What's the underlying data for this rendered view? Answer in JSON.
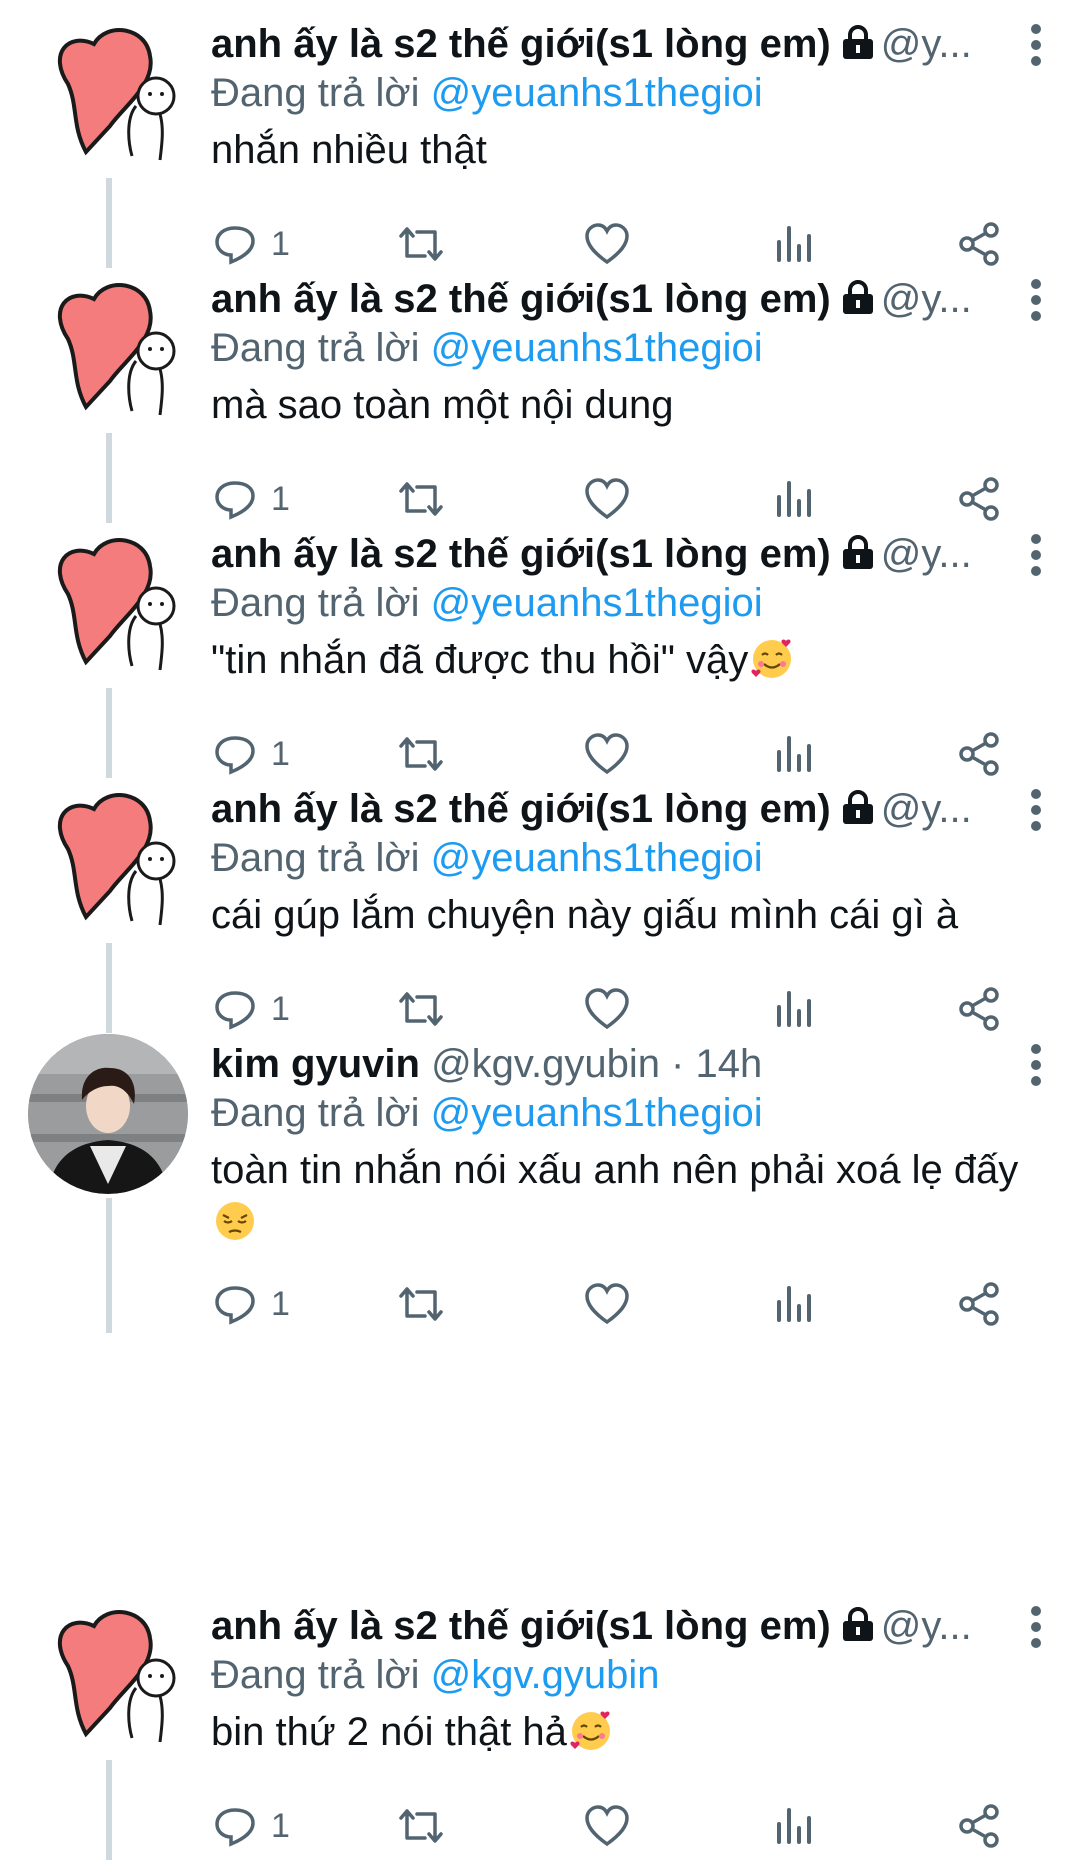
{
  "tweets": [
    {
      "name": "anh ấy là s2 thế giới(s1 lòng em)",
      "handle": "@y...",
      "reply_prefix": "Đang trả lời",
      "reply_to": "@yeuanhs1thegioi",
      "text": "nhắn nhiều thật",
      "reply_count": "1"
    },
    {
      "name": "anh ấy là s2 thế giới(s1 lòng em)",
      "handle": "@y...",
      "reply_prefix": "Đang trả lời",
      "reply_to": "@yeuanhs1thegioi",
      "text": "mà sao toàn một nội dung",
      "reply_count": "1"
    },
    {
      "name": "anh ấy là s2 thế giới(s1 lòng em)",
      "handle": "@y...",
      "reply_prefix": "Đang trả lời",
      "reply_to": "@yeuanhs1thegioi",
      "text": "\"tin nhắn đã được thu hồi\" vậy",
      "emoji": "smiling-hearts-emoji",
      "reply_count": "1"
    },
    {
      "name": "anh ấy là s2 thế giới(s1 lòng em)",
      "handle": "@y...",
      "reply_prefix": "Đang trả lời",
      "reply_to": "@yeuanhs1thegioi",
      "text": "cái gúp lắm chuyện này giấu mình cái gì à",
      "reply_count": "1"
    },
    {
      "name": "kim gyuvin",
      "handle": "@kgv.gyubin · 14h",
      "reply_prefix": "Đang trả lời",
      "reply_to": "@yeuanhs1thegioi",
      "text": "toàn tin nhắn nói xấu anh nên phải xoá lẹ đấy",
      "emoji": "pensive-emoji",
      "reply_count": "1"
    },
    {
      "name": "anh ấy là s2 thế giới(s1 lòng em)",
      "handle": "@y...",
      "reply_prefix": "Đang trả lời",
      "reply_to": "@kgv.gyubin",
      "text": "bin thứ 2 nói thật hả",
      "emoji": "smiling-hearts-emoji",
      "reply_count": "1"
    }
  ],
  "colors": {
    "accent": "#1d9bf0",
    "secondary_text": "#536471",
    "heart": "#f47c7c",
    "thread_line": "#cfd9de"
  }
}
